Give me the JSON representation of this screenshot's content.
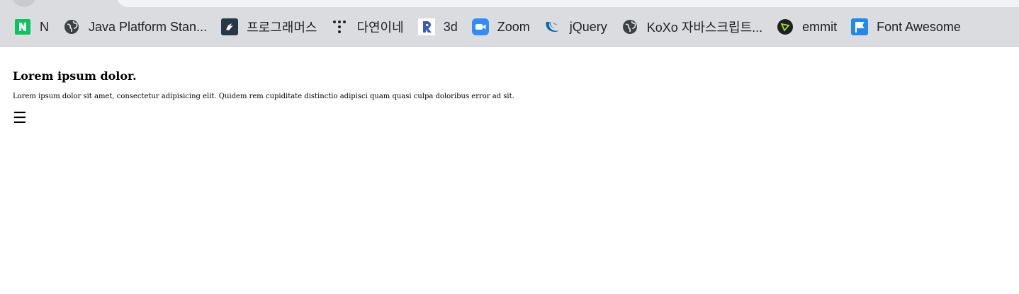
{
  "bookmarks": [
    {
      "label": "N",
      "icon": "naver-icon",
      "color": "#03c75a"
    },
    {
      "label": "Java Platform Stan...",
      "icon": "globe-icon",
      "color": "#3c4043"
    },
    {
      "label": "프로그래머스",
      "icon": "programmers-icon",
      "color": "#263747"
    },
    {
      "label": "다연이네",
      "icon": "dots-icon",
      "color": "#202124"
    },
    {
      "label": "3d",
      "icon": "r-logo-icon",
      "color": "#3a5bb8"
    },
    {
      "label": "Zoom",
      "icon": "zoom-icon",
      "color": "#2d8cff"
    },
    {
      "label": "jQuery",
      "icon": "jquery-icon",
      "color": "#0769ad"
    },
    {
      "label": "KoXo 자바스크립트...",
      "icon": "globe-icon",
      "color": "#3c4043"
    },
    {
      "label": "emmit",
      "icon": "emmet-icon",
      "color": "#1f1f1f"
    },
    {
      "label": "Font Awesome",
      "icon": "flag-icon",
      "color": "#228ae6"
    }
  ],
  "page": {
    "heading": "Lorem ipsum dolor.",
    "paragraph": "Lorem ipsum dolor sit amet, consectetur adipisicing elit. Quidem rem cupiditate distinctio adipisci quam quasi culpa doloribus error ad sit.",
    "menu_icon": "☰"
  }
}
